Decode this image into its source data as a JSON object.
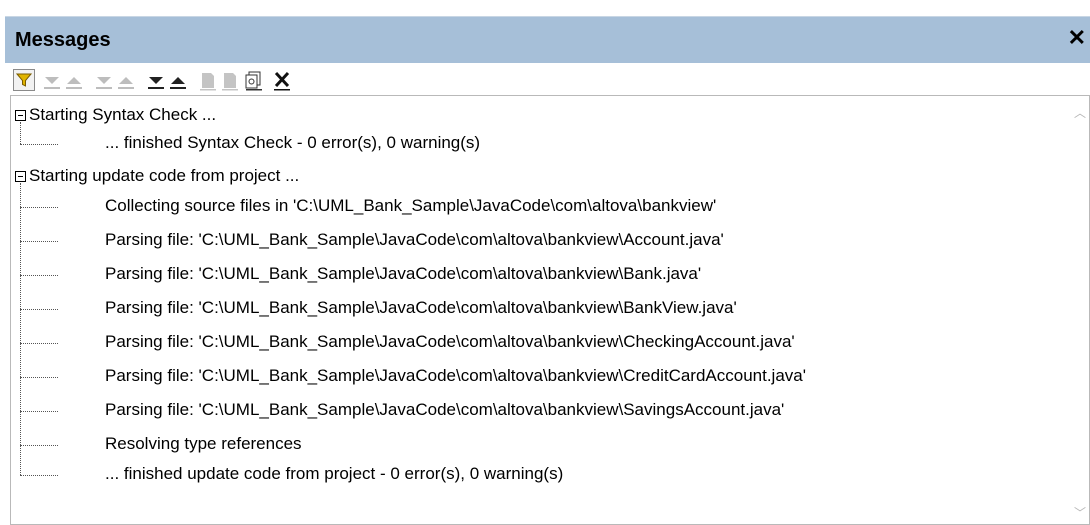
{
  "window": {
    "title": "Messages",
    "close_label": "✕"
  },
  "toolbar": {
    "buttons": [
      {
        "name": "filter-button",
        "icon": "filter-icon",
        "color": "#c9a000"
      },
      {
        "name": "next-warning-button",
        "icon": "arrow-down-icon"
      },
      {
        "name": "previous-warning-button",
        "icon": "arrow-up-icon"
      },
      {
        "name": "next-info-button",
        "icon": "arrow-down-icon"
      },
      {
        "name": "previous-info-button",
        "icon": "arrow-up-icon"
      },
      {
        "name": "next-message-button",
        "icon": "arrow-down-icon"
      },
      {
        "name": "previous-message-button",
        "icon": "arrow-up-icon"
      },
      {
        "name": "copy-button",
        "icon": "copy-icon"
      },
      {
        "name": "copy-all-button",
        "icon": "copy-all-icon"
      },
      {
        "name": "find-button",
        "icon": "find-icon"
      },
      {
        "name": "clear-button",
        "icon": "clear-icon"
      }
    ]
  },
  "messages": {
    "group1": {
      "header": "Starting Syntax Check ...",
      "children": [
        "... finished Syntax Check - 0 error(s), 0 warning(s)"
      ]
    },
    "group2": {
      "header": "Starting update code from project ...",
      "children": [
        "Collecting source files in 'C:\\UML_Bank_Sample\\JavaCode\\com\\altova\\bankview'",
        "Parsing file: 'C:\\UML_Bank_Sample\\JavaCode\\com\\altova\\bankview\\Account.java'",
        "Parsing file: 'C:\\UML_Bank_Sample\\JavaCode\\com\\altova\\bankview\\Bank.java'",
        "Parsing file: 'C:\\UML_Bank_Sample\\JavaCode\\com\\altova\\bankview\\BankView.java'",
        "Parsing file: 'C:\\UML_Bank_Sample\\JavaCode\\com\\altova\\bankview\\CheckingAccount.java'",
        "Parsing file: 'C:\\UML_Bank_Sample\\JavaCode\\com\\altova\\bankview\\CreditCardAccount.java'",
        "Parsing file: 'C:\\UML_Bank_Sample\\JavaCode\\com\\altova\\bankview\\SavingsAccount.java'",
        "Resolving type references",
        "... finished update code from project - 0 error(s), 0 warning(s)"
      ]
    }
  },
  "colors": {
    "titlebar": "#a6bfd8",
    "border": "#b9b9b9"
  }
}
